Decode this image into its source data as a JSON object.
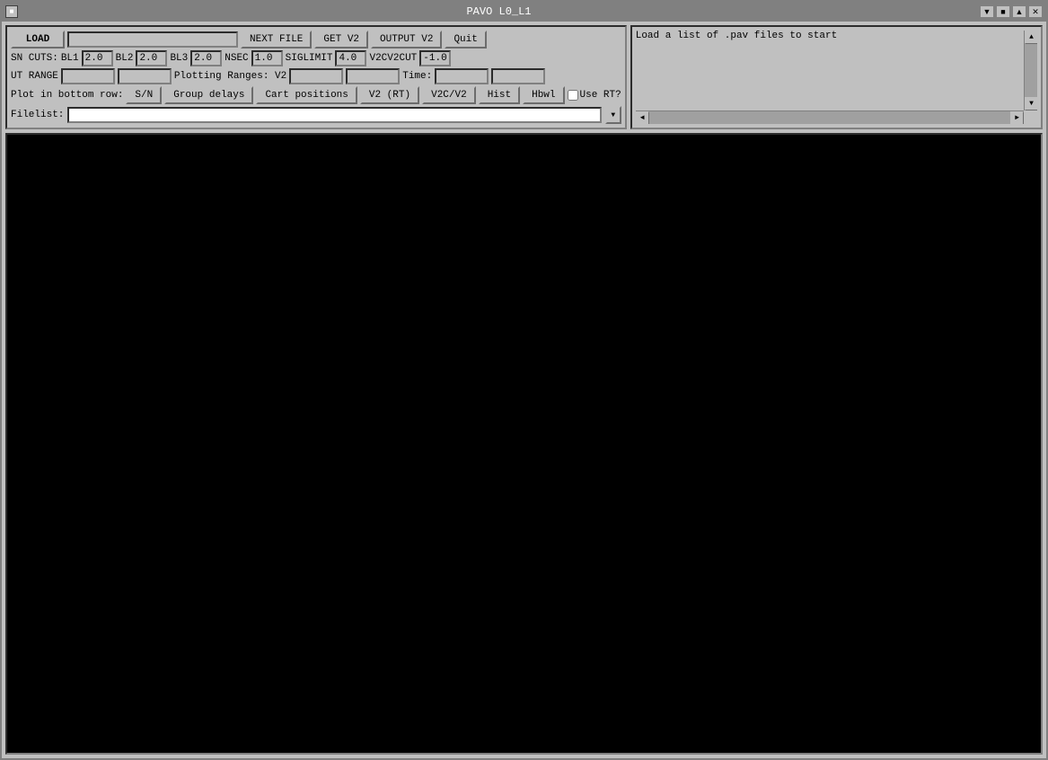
{
  "window": {
    "title": "PAVO L0_L1",
    "icon_label": "■"
  },
  "titlebar": {
    "minimize_label": "▼",
    "maximize_label": "▲",
    "restore_label": "■",
    "close_label": "✕"
  },
  "toolbar": {
    "load_label": "LOAD",
    "load_input_value": "",
    "next_file_label": "NEXT FILE",
    "get_v2_label": "GET V2",
    "output_v2_label": "OUTPUT V2",
    "quit_label": "Quit"
  },
  "sn_cuts": {
    "label": "SN CUTS:",
    "bl1_label": "BL1",
    "bl1_value": "2.0",
    "bl2_label": "BL2",
    "bl2_value": "2.0",
    "bl3_label": "BL3",
    "bl3_value": "2.0",
    "nsec_label": "NSEC",
    "nsec_value": "1.0",
    "siglimit_label": "SIGLIMIT",
    "siglimit_value": "4.0",
    "v2cv2cut_label": "V2CV2CUT",
    "v2cv2cut_value": "-1.0"
  },
  "ut_range": {
    "label": "UT RANGE",
    "from_value": "",
    "to_value": "",
    "plotting_label": "Plotting Ranges: V2",
    "v2_from_value": "",
    "v2_to_value": "",
    "time_label": "Time:",
    "time_from_value": "",
    "time_to_value": ""
  },
  "plot_row": {
    "label": "Plot in bottom row:",
    "sn_label": "S/N",
    "group_delays_label": "Group delays",
    "cart_positions_label": "Cart positions",
    "v2rt_label": "V2 (RT)",
    "v2cv2_label": "V2C/V2",
    "hist_label": "Hist",
    "hbwl_label": "Hbwl",
    "use_rt_label": "Use RT?",
    "use_rt_checked": false
  },
  "filelist": {
    "label": "Filelist:",
    "value": ""
  },
  "output_panel": {
    "text": "Load a list of .pav files to start"
  }
}
